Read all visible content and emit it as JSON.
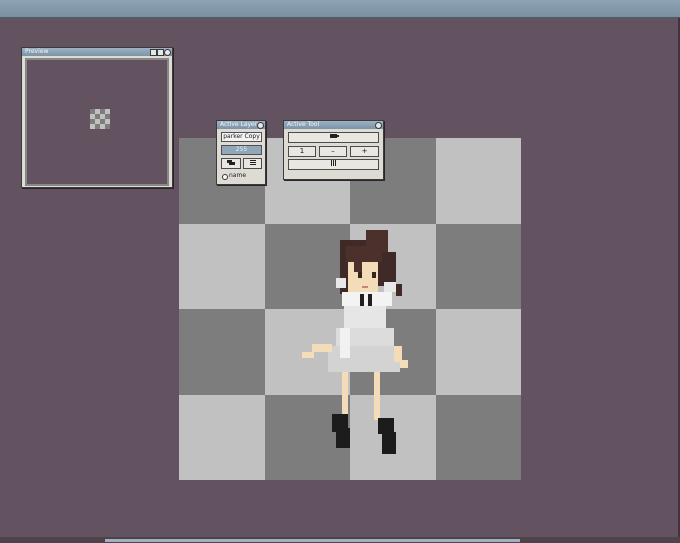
{
  "window": {
    "titlebar_color": "#8ea3b3",
    "workspace_color": "#635360"
  },
  "preview_panel": {
    "title": "Preview"
  },
  "layer_panel": {
    "title": "Active Layer",
    "layer_name": "parker Copy",
    "opacity": "255",
    "new_layer_icon": "layers-icon",
    "menu_icon": "menu-icon",
    "radio_label": "name"
  },
  "tool_panel": {
    "title": "Active Tool",
    "brush_icon": "brush-icon",
    "size_value": "1",
    "decrease_label": "–",
    "increase_label": "+",
    "pattern_icon": "pattern-icon"
  },
  "canvas": {
    "checker_light": "#c1c1c1",
    "checker_dark": "#7d7d7d",
    "pattern": [
      "d",
      "l",
      "d",
      "l",
      "l",
      "d",
      "l",
      "d",
      "d",
      "l",
      "d",
      "l",
      "l",
      "d",
      "l",
      "d"
    ],
    "sprite": "chibi girl with brown hair in white dress"
  }
}
